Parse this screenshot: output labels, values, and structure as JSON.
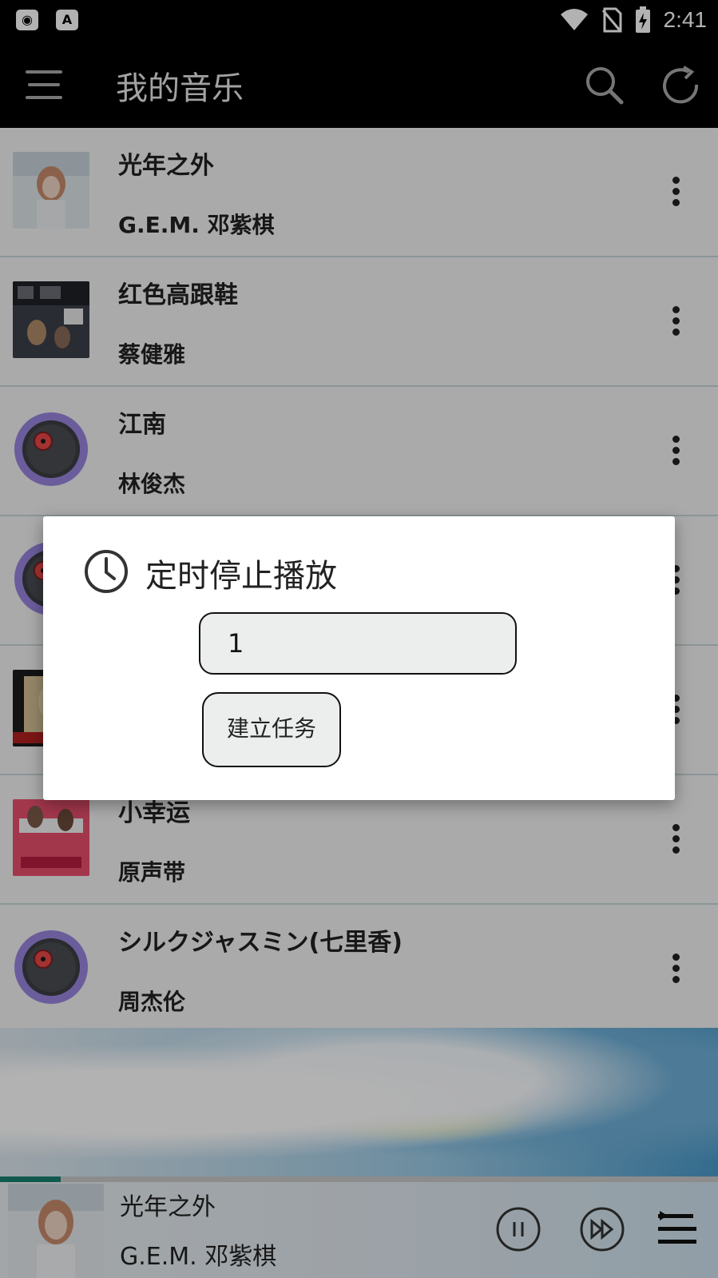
{
  "status_bar": {
    "time": "2:41",
    "left_icons": [
      "media-icon",
      "a-badge-icon"
    ],
    "a_badge_text": "A"
  },
  "app_bar": {
    "title": "我的音乐"
  },
  "songs": [
    {
      "title": "光年之外",
      "artist": "G.E.M. 邓紫棋",
      "art": "cover-photo"
    },
    {
      "title": "红色高跟鞋",
      "artist": "蔡健雅",
      "art": "cover-photo"
    },
    {
      "title": "江南",
      "artist": "林俊杰",
      "art": "vinyl-icon"
    },
    {
      "title": "",
      "artist": "",
      "art": "vinyl-icon"
    },
    {
      "title": "",
      "artist": "",
      "art": "cover-photo"
    },
    {
      "title": "小幸运",
      "artist": "原声带",
      "art": "cover-photo"
    },
    {
      "title": "シルクジャスミン(七里香)",
      "artist": "周杰伦",
      "art": "vinyl-icon"
    }
  ],
  "now_playing": {
    "title": "光年之外",
    "artist": "G.E.M. 邓紫棋",
    "progress": 0.085
  },
  "dialog": {
    "title": "定时停止播放",
    "input_value": "1",
    "button_label": "建立任务"
  },
  "colors": {
    "accent": "#17806f",
    "appbar": "#000000",
    "vinyl_ring": "#9a86e0",
    "vinyl_label": "#e84848"
  }
}
